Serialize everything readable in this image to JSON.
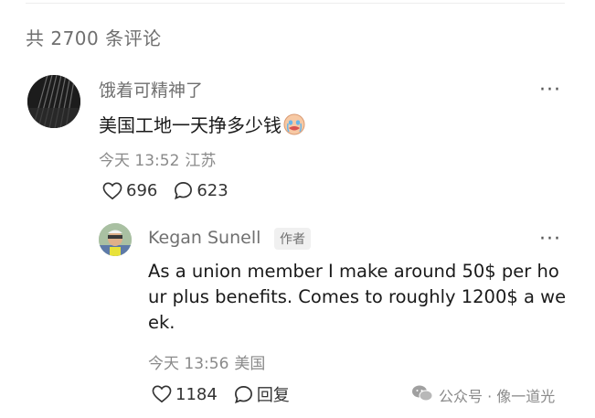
{
  "comments_header": {
    "count_text": "共 2700 条评论"
  },
  "main_comment": {
    "author": "饿着可精神了",
    "text": "美国工地一天挣多少钱",
    "emoji": "crying-face-emoji",
    "time": "今天 13:52",
    "location": "江苏",
    "likes": "696",
    "replies": "623",
    "more": "···"
  },
  "reply": {
    "author": "Kegan Sunell",
    "badge": "作者",
    "text": "As a union member I make around 50$ per hour plus benefits. Comes to roughly 1200$ a week.",
    "time": "今天 13:56",
    "location": "美国",
    "likes": "1184",
    "reply_label": "回复",
    "more": "···"
  },
  "watermark": {
    "text": "公众号 · 像一道光"
  },
  "colors": {
    "meta_gray": "#8a8a8a",
    "text": "#1a1a1a",
    "author_gray": "#707070"
  }
}
